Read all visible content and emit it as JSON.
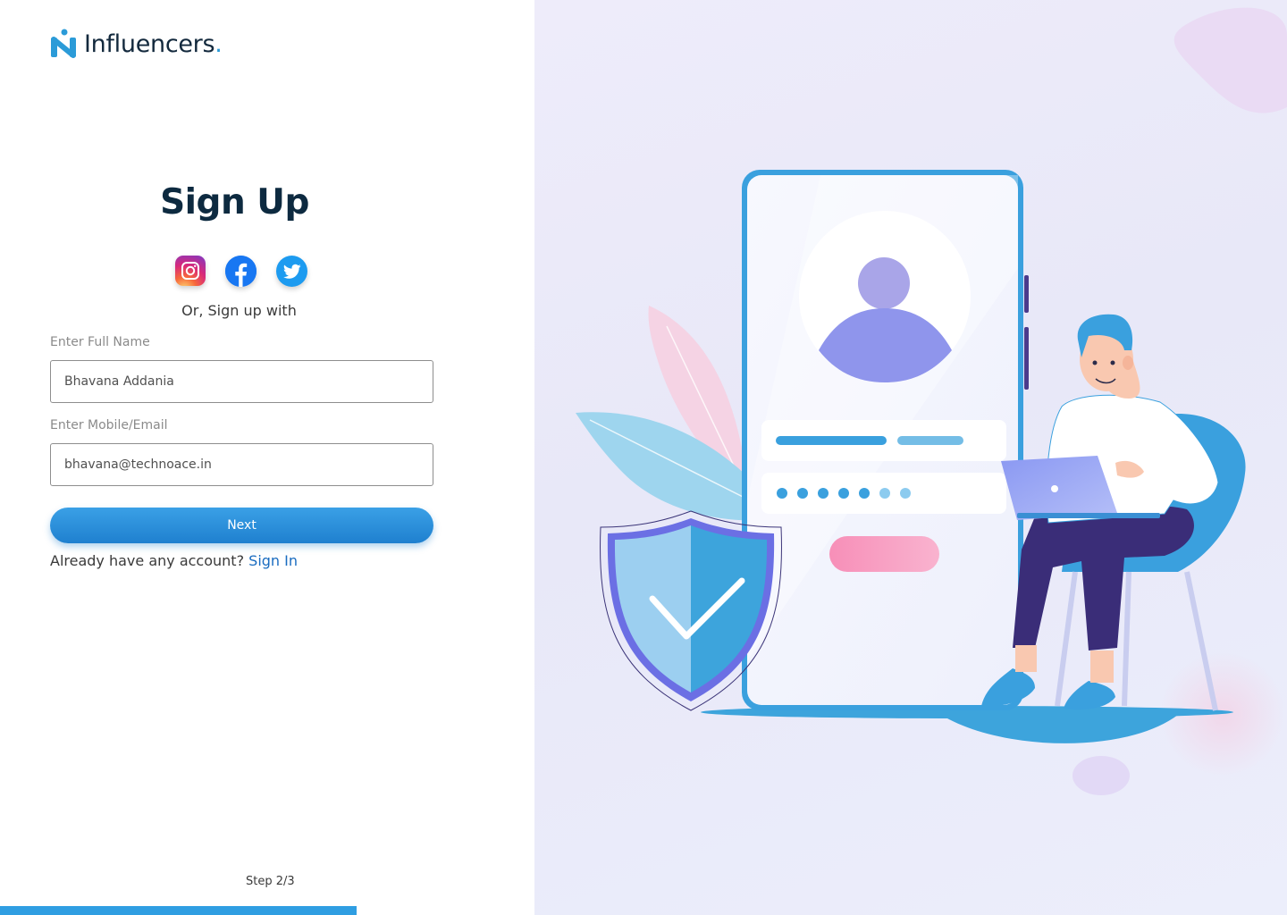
{
  "brand": {
    "name": "Influencers",
    "dot": ".",
    "accent_color": "#2b9bd8"
  },
  "form": {
    "title": "Sign Up",
    "social_icons": [
      "instagram-icon",
      "facebook-icon",
      "twitter-icon"
    ],
    "or_text": "Or, Sign up with",
    "full_name": {
      "label": "Enter Full Name",
      "value": "Bhavana Addania"
    },
    "contact": {
      "label": "Enter Mobile/Email",
      "value": "bhavana@technoace.in"
    },
    "next_label": "Next",
    "signin_prompt": "Already have any account?",
    "signin_link": "Sign In"
  },
  "progress": {
    "step_text": "Step 2/3",
    "fraction": 0.6667,
    "color": "#2f9ee2"
  }
}
